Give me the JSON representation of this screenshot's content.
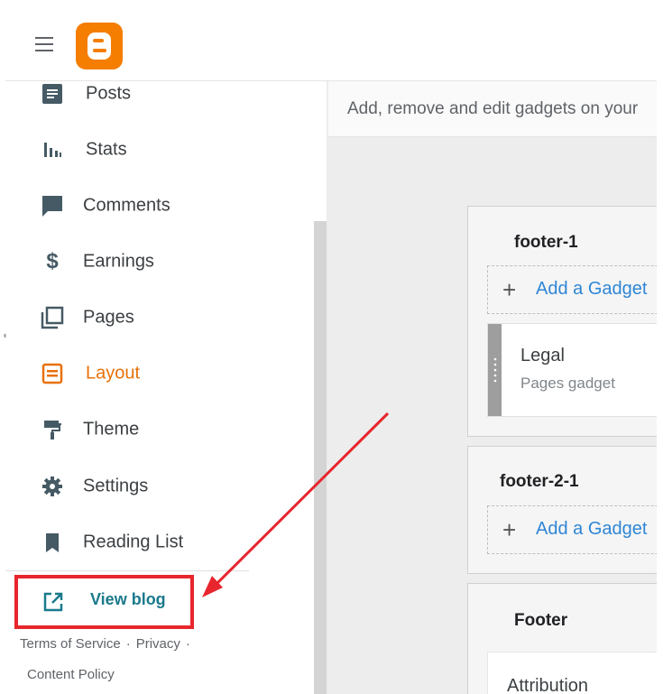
{
  "nav": {
    "items": [
      {
        "label": "Posts",
        "icon": "posts-icon"
      },
      {
        "label": "Stats",
        "icon": "stats-icon"
      },
      {
        "label": "Comments",
        "icon": "comments-icon"
      },
      {
        "label": "Earnings",
        "icon": "dollar-icon"
      },
      {
        "label": "Pages",
        "icon": "pages-icon"
      },
      {
        "label": "Layout",
        "icon": "layout-icon",
        "active": true
      },
      {
        "label": "Theme",
        "icon": "paint-roller-icon"
      },
      {
        "label": "Settings",
        "icon": "gear-icon"
      },
      {
        "label": "Reading List",
        "icon": "bookmark-icon"
      }
    ],
    "view_blog": "View blog"
  },
  "footer": {
    "terms": "Terms of Service",
    "separator": "·",
    "privacy": "Privacy",
    "content_policy": "Content Policy"
  },
  "main": {
    "description": "Add, remove and edit gadgets on your"
  },
  "sections": [
    {
      "title": "footer-1",
      "add_label": "Add a Gadget",
      "gadget": {
        "title": "Legal",
        "subtitle": "Pages gadget"
      }
    },
    {
      "title": "footer-2-1",
      "add_label": "Add a Gadget"
    },
    {
      "title": "Footer",
      "gadget": {
        "title": "Attribution"
      }
    }
  ],
  "colors": {
    "active": "#e8710a",
    "link": "#2f86d6",
    "highlight": "#e8262d",
    "view_blog": "#1b7a8c",
    "brand": "#f57d00"
  }
}
